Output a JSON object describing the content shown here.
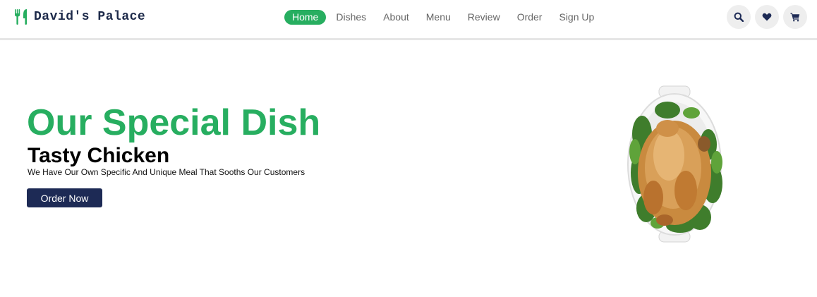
{
  "brand": {
    "name": "David's Palace",
    "accent_color": "#27ae60",
    "dark_color": "#1d2a55"
  },
  "nav": {
    "items": [
      {
        "label": "Home",
        "active": true
      },
      {
        "label": "Dishes"
      },
      {
        "label": "About"
      },
      {
        "label": "Menu"
      },
      {
        "label": "Review"
      },
      {
        "label": "Order"
      },
      {
        "label": "Sign Up"
      }
    ]
  },
  "header_icons": [
    "search-icon",
    "heart-icon",
    "cart-icon"
  ],
  "hero": {
    "title": "Our Special Dish",
    "subtitle": "Tasty Chicken",
    "description": "We Have Our Own Specific And Unique Meal That Sooths Our Customers",
    "button_label": "Order Now",
    "image": "roast-chicken-dish"
  }
}
